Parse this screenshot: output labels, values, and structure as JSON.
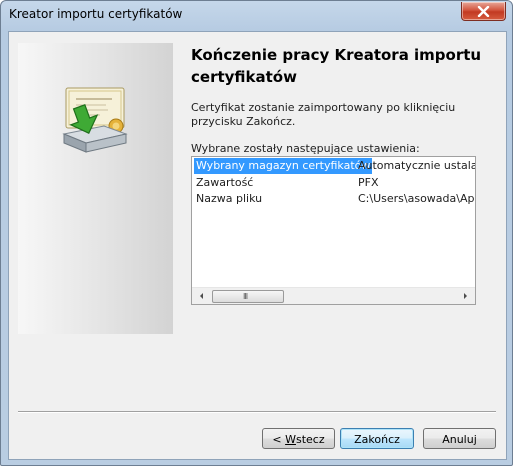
{
  "window": {
    "title": "Kreator importu certyfikatów"
  },
  "page": {
    "heading": "Kończenie pracy Kreatora importu certyfikatów",
    "description": "Certyfikat zostanie zaimportowany po kliknięciu przycisku Zakończ.",
    "settings_label": "Wybrane zostały następujące ustawienia:"
  },
  "settings": {
    "rows": [
      {
        "name": "Wybrany magazyn certyfikatów",
        "value": "Automatycznie ustalane",
        "selected": true
      },
      {
        "name": "Zawartość",
        "value": "PFX",
        "selected": false
      },
      {
        "name": "Nazwa pliku",
        "value": "C:\\Users\\asowada\\AppData",
        "selected": false
      }
    ],
    "scroll_grip": "III"
  },
  "buttons": {
    "back_prefix": "< ",
    "back_accel": "W",
    "back_rest": "stecz",
    "finish": "Zakończ",
    "cancel": "Anuluj"
  },
  "icons": {
    "close": "close-icon",
    "wizard": "certificate-import-icon",
    "scroll_left": "arrow-left-icon",
    "scroll_right": "arrow-right-icon"
  },
  "colors": {
    "selection": "#3399ff",
    "close_button": "#c9452c",
    "default_button_border": "#3c7fb1"
  }
}
